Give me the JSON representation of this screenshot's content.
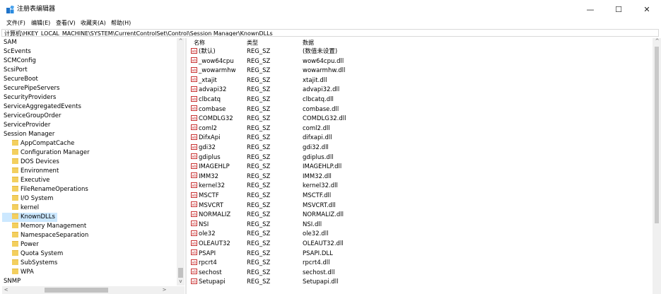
{
  "window": {
    "title": "注册表编辑器",
    "minimize_glyph": "—",
    "maximize_glyph": "☐",
    "close_glyph": "✕"
  },
  "menu": [
    "文件(F)",
    "编辑(E)",
    "查看(V)",
    "收藏夹(A)",
    "帮助(H)"
  ],
  "address": "计算机\\HKEY_LOCAL_MACHINE\\SYSTEM\\CurrentControlSet\\Control\\Session Manager\\KnownDLLs",
  "tree": {
    "items": [
      {
        "label": "SAM",
        "level": 0
      },
      {
        "label": "ScEvents",
        "level": 0
      },
      {
        "label": "SCMConfig",
        "level": 0
      },
      {
        "label": "ScsiPort",
        "level": 0
      },
      {
        "label": "SecureBoot",
        "level": 0
      },
      {
        "label": "SecurePipeServers",
        "level": 0
      },
      {
        "label": "SecurityProviders",
        "level": 0
      },
      {
        "label": "ServiceAggregatedEvents",
        "level": 0
      },
      {
        "label": "ServiceGroupOrder",
        "level": 0
      },
      {
        "label": "ServiceProvider",
        "level": 0
      },
      {
        "label": "Session Manager",
        "level": 0
      },
      {
        "label": "AppCompatCache",
        "level": 1
      },
      {
        "label": "Configuration Manager",
        "level": 1
      },
      {
        "label": "DOS Devices",
        "level": 1
      },
      {
        "label": "Environment",
        "level": 1
      },
      {
        "label": "Executive",
        "level": 1
      },
      {
        "label": "FileRenameOperations",
        "level": 1
      },
      {
        "label": "I/O System",
        "level": 1
      },
      {
        "label": "kernel",
        "level": 1
      },
      {
        "label": "KnownDLLs",
        "level": 1,
        "selected": true
      },
      {
        "label": "Memory Management",
        "level": 1
      },
      {
        "label": "NamespaceSeparation",
        "level": 1
      },
      {
        "label": "Power",
        "level": 1
      },
      {
        "label": "Quota System",
        "level": 1
      },
      {
        "label": "SubSystems",
        "level": 1
      },
      {
        "label": "WPA",
        "level": 1
      },
      {
        "label": "SNMP",
        "level": 0
      }
    ]
  },
  "columns": {
    "name": "名称",
    "type": "类型",
    "data": "数据"
  },
  "values": [
    {
      "name": "(默认)",
      "type": "REG_SZ",
      "data": "(数值未设置)"
    },
    {
      "name": "_wow64cpu",
      "type": "REG_SZ",
      "data": "wow64cpu.dll"
    },
    {
      "name": "_wowarmhw",
      "type": "REG_SZ",
      "data": "wowarmhw.dll"
    },
    {
      "name": "_xtajit",
      "type": "REG_SZ",
      "data": "xtajit.dll"
    },
    {
      "name": "advapi32",
      "type": "REG_SZ",
      "data": "advapi32.dll"
    },
    {
      "name": "clbcatq",
      "type": "REG_SZ",
      "data": "clbcatq.dll"
    },
    {
      "name": "combase",
      "type": "REG_SZ",
      "data": "combase.dll"
    },
    {
      "name": "COMDLG32",
      "type": "REG_SZ",
      "data": "COMDLG32.dll"
    },
    {
      "name": "coml2",
      "type": "REG_SZ",
      "data": "coml2.dll"
    },
    {
      "name": "DifxApi",
      "type": "REG_SZ",
      "data": "difxapi.dll"
    },
    {
      "name": "gdi32",
      "type": "REG_SZ",
      "data": "gdi32.dll"
    },
    {
      "name": "gdiplus",
      "type": "REG_SZ",
      "data": "gdiplus.dll"
    },
    {
      "name": "IMAGEHLP",
      "type": "REG_SZ",
      "data": "IMAGEHLP.dll"
    },
    {
      "name": "IMM32",
      "type": "REG_SZ",
      "data": "IMM32.dll"
    },
    {
      "name": "kernel32",
      "type": "REG_SZ",
      "data": "kernel32.dll"
    },
    {
      "name": "MSCTF",
      "type": "REG_SZ",
      "data": "MSCTF.dll"
    },
    {
      "name": "MSVCRT",
      "type": "REG_SZ",
      "data": "MSVCRT.dll"
    },
    {
      "name": "NORMALIZ",
      "type": "REG_SZ",
      "data": "NORMALIZ.dll"
    },
    {
      "name": "NSI",
      "type": "REG_SZ",
      "data": "NSI.dll"
    },
    {
      "name": "ole32",
      "type": "REG_SZ",
      "data": "ole32.dll"
    },
    {
      "name": "OLEAUT32",
      "type": "REG_SZ",
      "data": "OLEAUT32.dll"
    },
    {
      "name": "PSAPI",
      "type": "REG_SZ",
      "data": "PSAPI.DLL"
    },
    {
      "name": "rpcrt4",
      "type": "REG_SZ",
      "data": "rpcrt4.dll"
    },
    {
      "name": "sechost",
      "type": "REG_SZ",
      "data": "sechost.dll"
    },
    {
      "name": "Setupapi",
      "type": "REG_SZ",
      "data": "Setupapi.dll"
    }
  ],
  "icons": {
    "value": "ab",
    "arrow_up": "^",
    "arrow_down": "v",
    "arrow_left": "<",
    "arrow_right": ">"
  }
}
